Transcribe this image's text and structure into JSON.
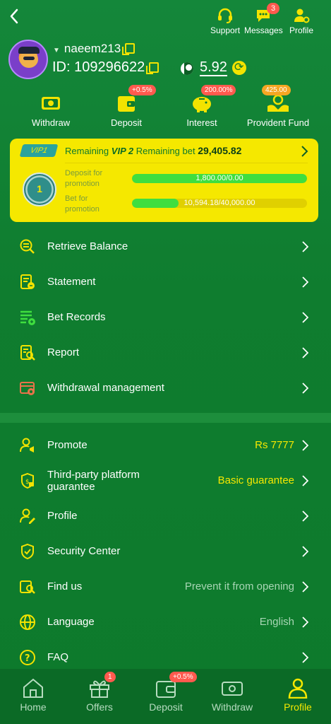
{
  "header": {
    "support_label": "Support",
    "messages_label": "Messages",
    "messages_badge": "3",
    "profile_label": "Profile"
  },
  "user": {
    "username": "naeem213",
    "id_label": "ID:",
    "id_value": "109296622",
    "balance": "5.92"
  },
  "quick_actions": [
    {
      "label": "Withdraw",
      "badge": ""
    },
    {
      "label": "Deposit",
      "badge": "+0.5%"
    },
    {
      "label": "Interest",
      "badge": "200.00%"
    },
    {
      "label": "Provident Fund",
      "badge": "425.00"
    }
  ],
  "vip": {
    "tag": "VIP1",
    "remaining_prefix": "Remaining",
    "next_level": "VIP 2",
    "remaining_bet_label": "Remaining bet",
    "remaining_bet_value": "29,405.82",
    "medal_level": "1",
    "deposit_label_1": "Deposit for",
    "deposit_label_2": "promotion",
    "deposit_progress": "1,800.00/0.00",
    "deposit_fraction": 1.0,
    "bet_label_1": "Bet for",
    "bet_label_2": "promotion",
    "bet_progress": "10,594.18/40,000.00",
    "bet_fraction": 0.265
  },
  "menu": {
    "retrieve_balance": "Retrieve Balance",
    "statement": "Statement",
    "bet_records": "Bet Records",
    "report": "Report",
    "withdrawal_management": "Withdrawal management",
    "promote": "Promote",
    "promote_value": "Rs 7777",
    "third_party_1": "Third-party platform",
    "third_party_2": "guarantee",
    "third_party_value": "Basic guarantee",
    "profile": "Profile",
    "security_center": "Security Center",
    "find_us": "Find us",
    "find_us_value": "Prevent it from opening",
    "language": "Language",
    "language_value": "English",
    "faq": "FAQ"
  },
  "bottom_nav": [
    {
      "label": "Home",
      "badge": ""
    },
    {
      "label": "Offers",
      "badge": "1"
    },
    {
      "label": "Deposit",
      "badge": "+0.5%"
    },
    {
      "label": "Withdraw",
      "badge": ""
    },
    {
      "label": "Profile",
      "badge": ""
    }
  ],
  "colors": {
    "background": "#0f7a2c",
    "accent_yellow": "#f5e800",
    "badge_red": "#ff5a4e",
    "progress_green": "#3fde3f"
  }
}
